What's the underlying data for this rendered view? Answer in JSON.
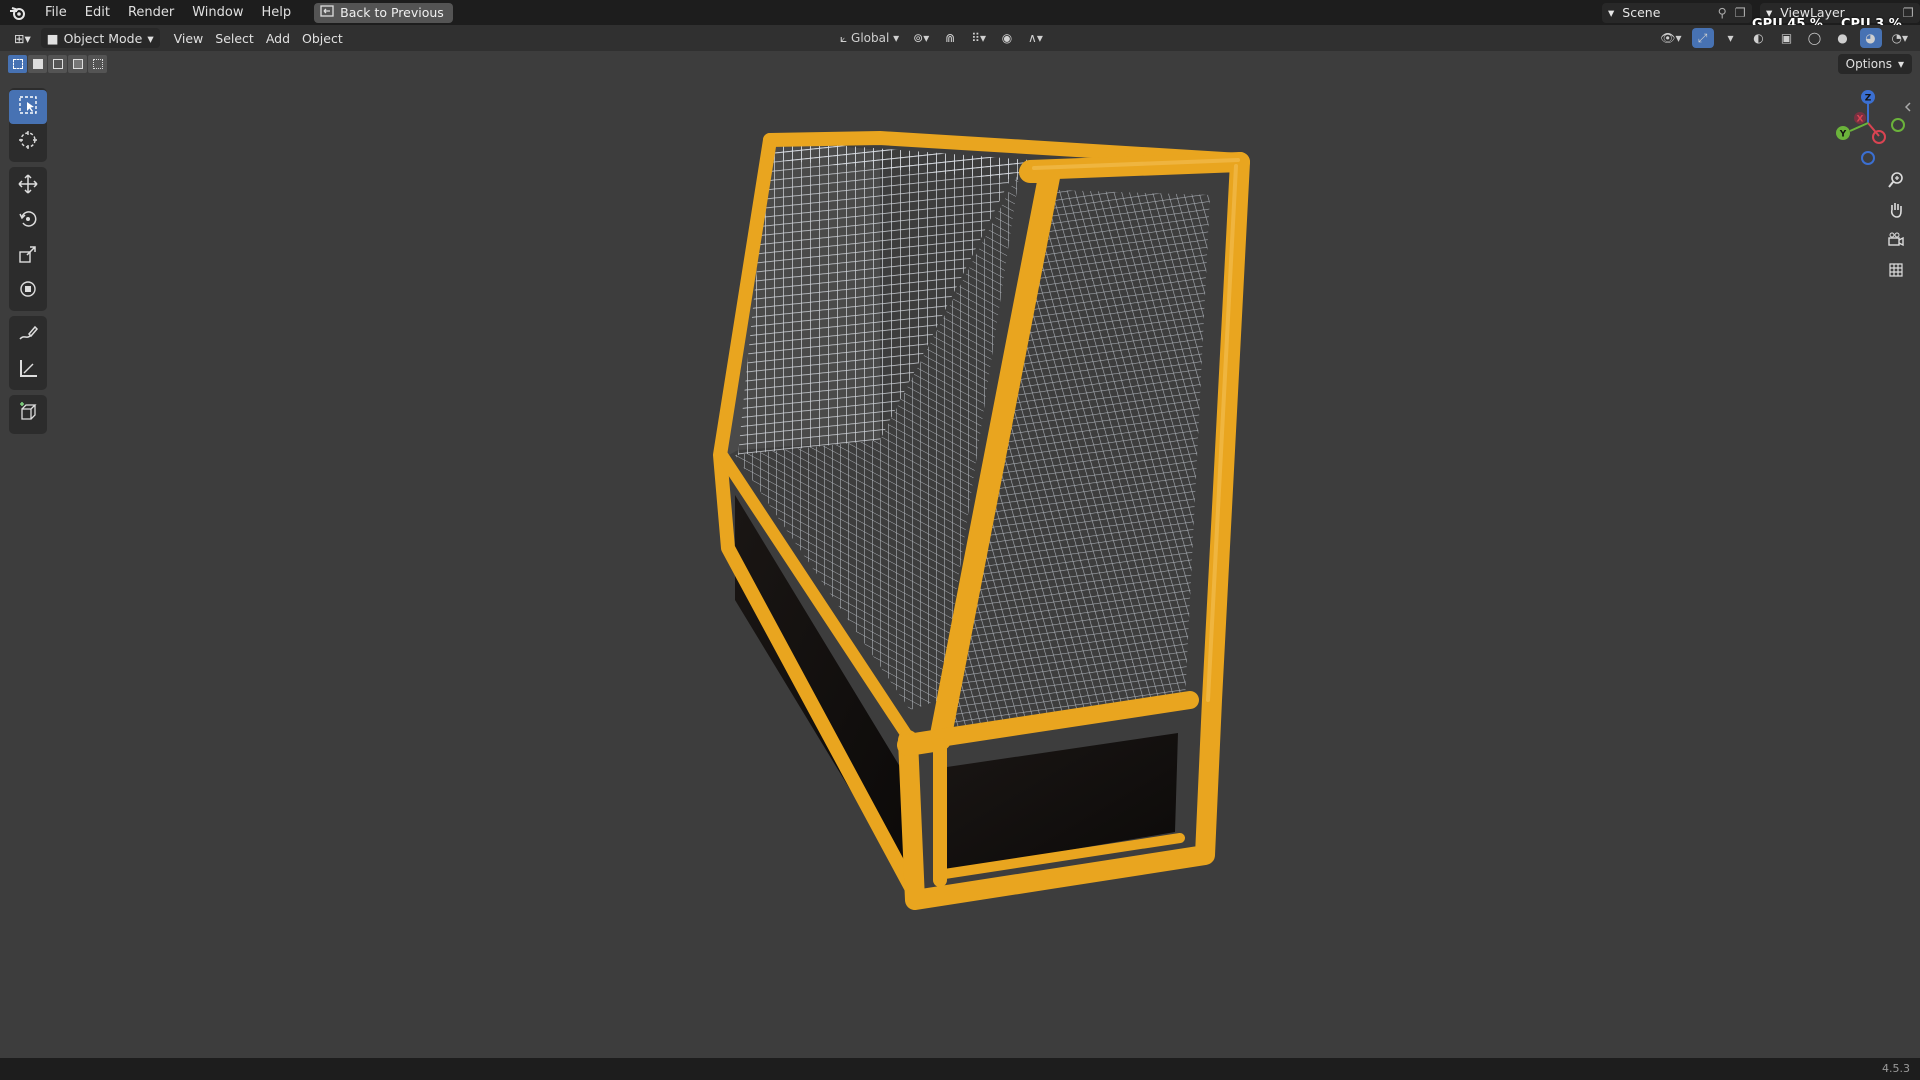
{
  "menu": {
    "items": [
      "File",
      "Edit",
      "Render",
      "Window",
      "Help"
    ],
    "back_button": "Back to Previous"
  },
  "topright": {
    "scene": "Scene",
    "view_layer": "ViewLayer",
    "gpu_label": "GPU",
    "gpu_value": "45 %",
    "cpu_label": "CPU",
    "cpu_value": "3 %"
  },
  "header": {
    "mode": "Object Mode",
    "menus": [
      "View",
      "Select",
      "Add",
      "Object"
    ],
    "transform_orientation": "Global",
    "options": "Options"
  },
  "toolbar": {
    "tools": [
      "select-box-icon",
      "cursor-icon",
      "move-icon",
      "rotate-icon",
      "scale-icon",
      "transform-icon",
      "annotate-icon",
      "measure-icon",
      "add-cube-icon"
    ],
    "active_tool": "select-box-icon"
  },
  "gizmo": {
    "x": "X",
    "y": "Y",
    "z": "Z"
  },
  "colors": {
    "frame": "#e9a51f",
    "mesh": "#d8dde4",
    "accent": "#4772b3",
    "background": "#3d3d3d"
  },
  "status": {
    "version": "4.5.3"
  }
}
